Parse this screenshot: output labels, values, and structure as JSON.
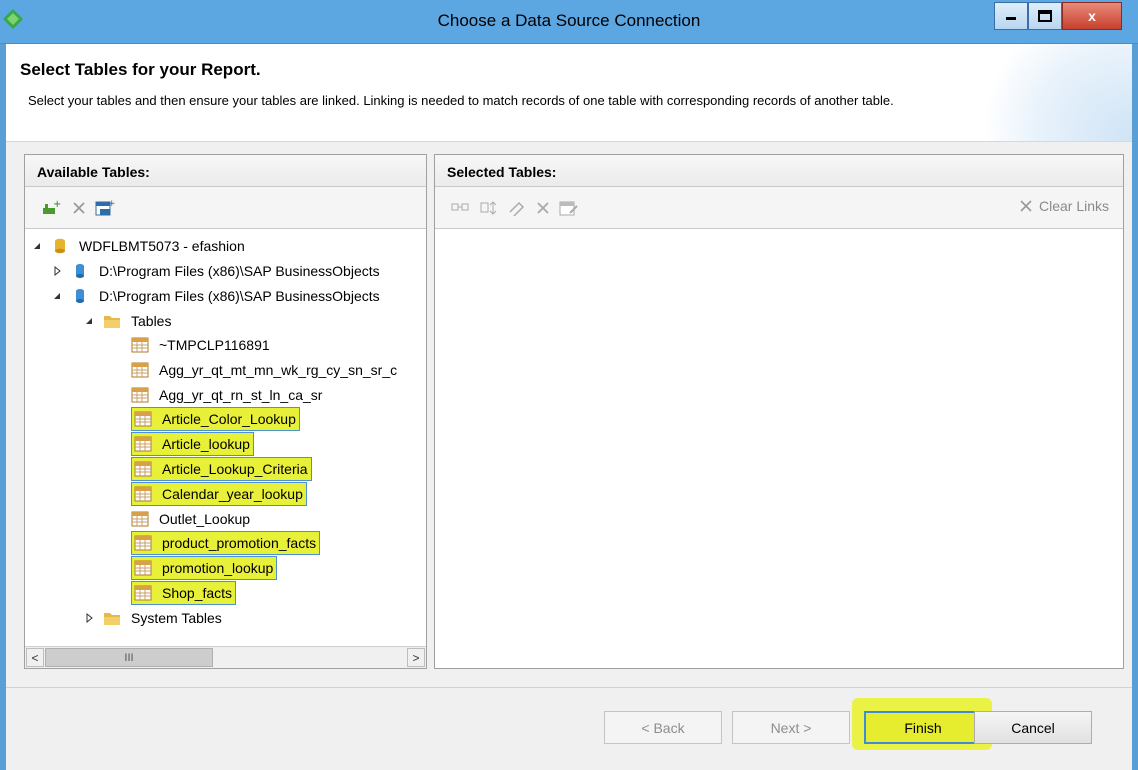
{
  "window": {
    "title": "Choose a Data Source Connection"
  },
  "header": {
    "title": "Select Tables for your Report.",
    "description": "Select your tables and then ensure your tables are linked. Linking is needed to match records of one table with corresponding records of another table."
  },
  "left_panel": {
    "title": "Available Tables:",
    "tree": {
      "root": "WDFLBMT5073 - efashion",
      "path_collapsed": "D:\\Program Files (x86)\\SAP BusinessObjects",
      "path_expanded": "D:\\Program Files (x86)\\SAP BusinessObjects",
      "tables_folder": "Tables",
      "tables": [
        {
          "name": "~TMPCLP116891",
          "highlighted": false
        },
        {
          "name": "Agg_yr_qt_mt_mn_wk_rg_cy_sn_sr_c",
          "highlighted": false
        },
        {
          "name": "Agg_yr_qt_rn_st_ln_ca_sr",
          "highlighted": false
        },
        {
          "name": "Article_Color_Lookup",
          "highlighted": true
        },
        {
          "name": "Article_lookup",
          "highlighted": true
        },
        {
          "name": "Article_Lookup_Criteria",
          "highlighted": true
        },
        {
          "name": "Calendar_year_lookup",
          "highlighted": true
        },
        {
          "name": "Outlet_Lookup",
          "highlighted": false
        },
        {
          "name": "product_promotion_facts",
          "highlighted": true
        },
        {
          "name": "promotion_lookup",
          "highlighted": true
        },
        {
          "name": "Shop_facts",
          "highlighted": true
        }
      ],
      "system_folder": "System Tables"
    },
    "scroll_thumb": "III"
  },
  "right_panel": {
    "title": "Selected Tables:",
    "clear_links": "Clear Links"
  },
  "buttons": {
    "back": "< Back",
    "next": "Next >",
    "finish": "Finish",
    "cancel": "Cancel"
  },
  "colors": {
    "titlebar": "#5ca6e2",
    "highlight": "#e9f03a",
    "selection_border": "#4f8fd9"
  }
}
